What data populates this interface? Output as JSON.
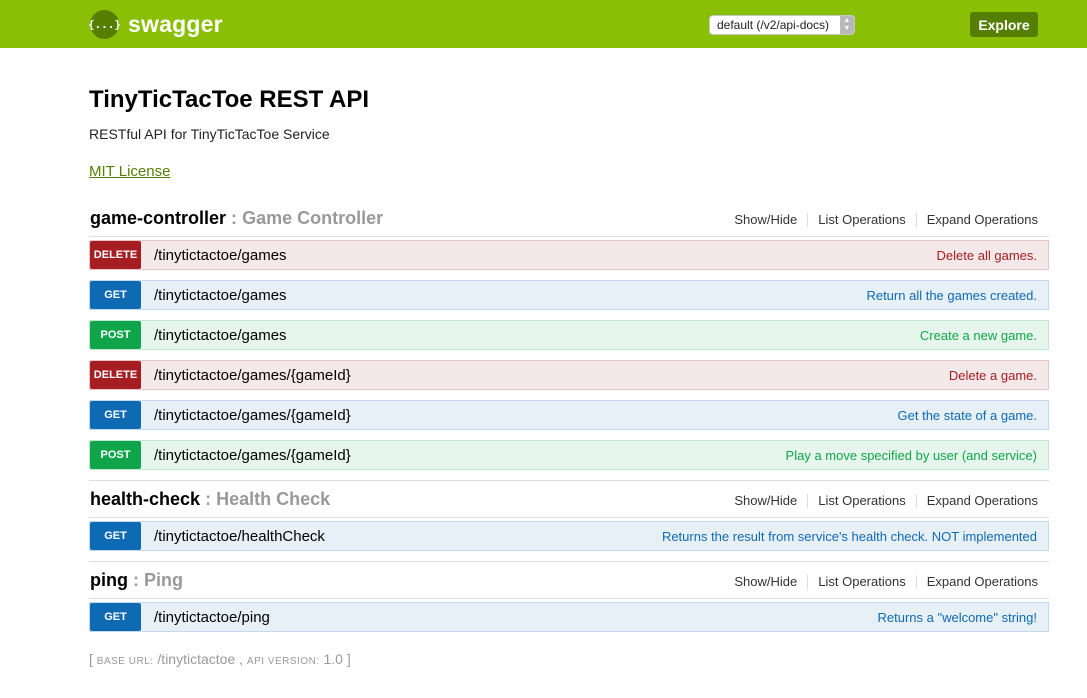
{
  "header": {
    "logo_glyph": "{...}",
    "logo_text": "swagger",
    "spec_selector": "default (/v2/api-docs)",
    "explore_label": "Explore",
    "colors": {
      "bar": "#89bf04",
      "accent": "#547f00"
    }
  },
  "info": {
    "title": "TinyTicTacToe REST API",
    "description": "RESTful API for TinyTicTacToe Service",
    "license": "MIT License"
  },
  "resource_links": {
    "show_hide": "Show/Hide",
    "list_operations": "List Operations",
    "expand_operations": "Expand Operations"
  },
  "resources": [
    {
      "name": "game-controller",
      "separator": ":",
      "description": "Game Controller",
      "operations": [
        {
          "method": "DELETE",
          "path": "/tinytictactoe/games",
          "summary": "Delete all games."
        },
        {
          "method": "GET",
          "path": "/tinytictactoe/games",
          "summary": "Return all the games created."
        },
        {
          "method": "POST",
          "path": "/tinytictactoe/games",
          "summary": "Create a new game."
        },
        {
          "method": "DELETE",
          "path": "/tinytictactoe/games/{gameId}",
          "summary": "Delete a game."
        },
        {
          "method": "GET",
          "path": "/tinytictactoe/games/{gameId}",
          "summary": "Get the state of a game."
        },
        {
          "method": "POST",
          "path": "/tinytictactoe/games/{gameId}",
          "summary": "Play a move specified by user (and service)"
        }
      ]
    },
    {
      "name": "health-check",
      "separator": ":",
      "description": "Health Check",
      "operations": [
        {
          "method": "GET",
          "path": "/tinytictactoe/healthCheck",
          "summary": "Returns the result from service's health check. NOT implemented"
        }
      ]
    },
    {
      "name": "ping",
      "separator": ":",
      "description": "Ping",
      "operations": [
        {
          "method": "GET",
          "path": "/tinytictactoe/ping",
          "summary": "Returns a \"welcome\" string!"
        }
      ]
    }
  ],
  "method_colors": {
    "DELETE": "#a41e22",
    "GET": "#0f6ab4",
    "POST": "#10a54a"
  },
  "footer": {
    "open": "[",
    "base_url_label": "BASE URL:",
    "base_url": "/tinytictactoe",
    "comma": ",",
    "api_version_label": "API VERSION:",
    "api_version": "1.0",
    "close": "]"
  }
}
